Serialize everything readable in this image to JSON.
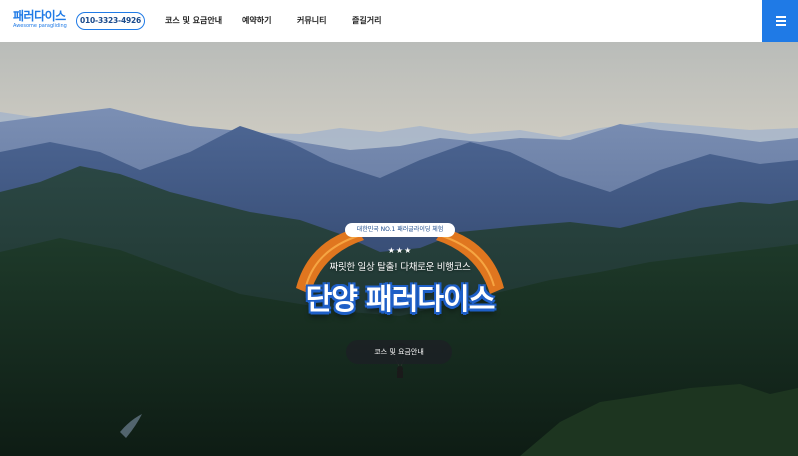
{
  "brand": {
    "logo_title": "패러다이스",
    "logo_subtitle": "Awesome paragliding",
    "phone": "010-3323-4926",
    "accent_color": "#1f7ae6"
  },
  "nav": {
    "items": [
      {
        "label": "코스 및 요금안내"
      },
      {
        "label": "예약하기"
      },
      {
        "label": "커뮤니티"
      },
      {
        "label": "즐길거리"
      }
    ],
    "menu_icon": "hamburger-icon"
  },
  "hero": {
    "ribbon_text": "대한민국 NO.1 패러글라이딩 체험",
    "stars": "★★★",
    "subtitle": "짜릿한 일상 탈출! 다채로운 비행코스",
    "title": "단양 패러다이스",
    "cta_label": "코스 및 요금안내"
  }
}
